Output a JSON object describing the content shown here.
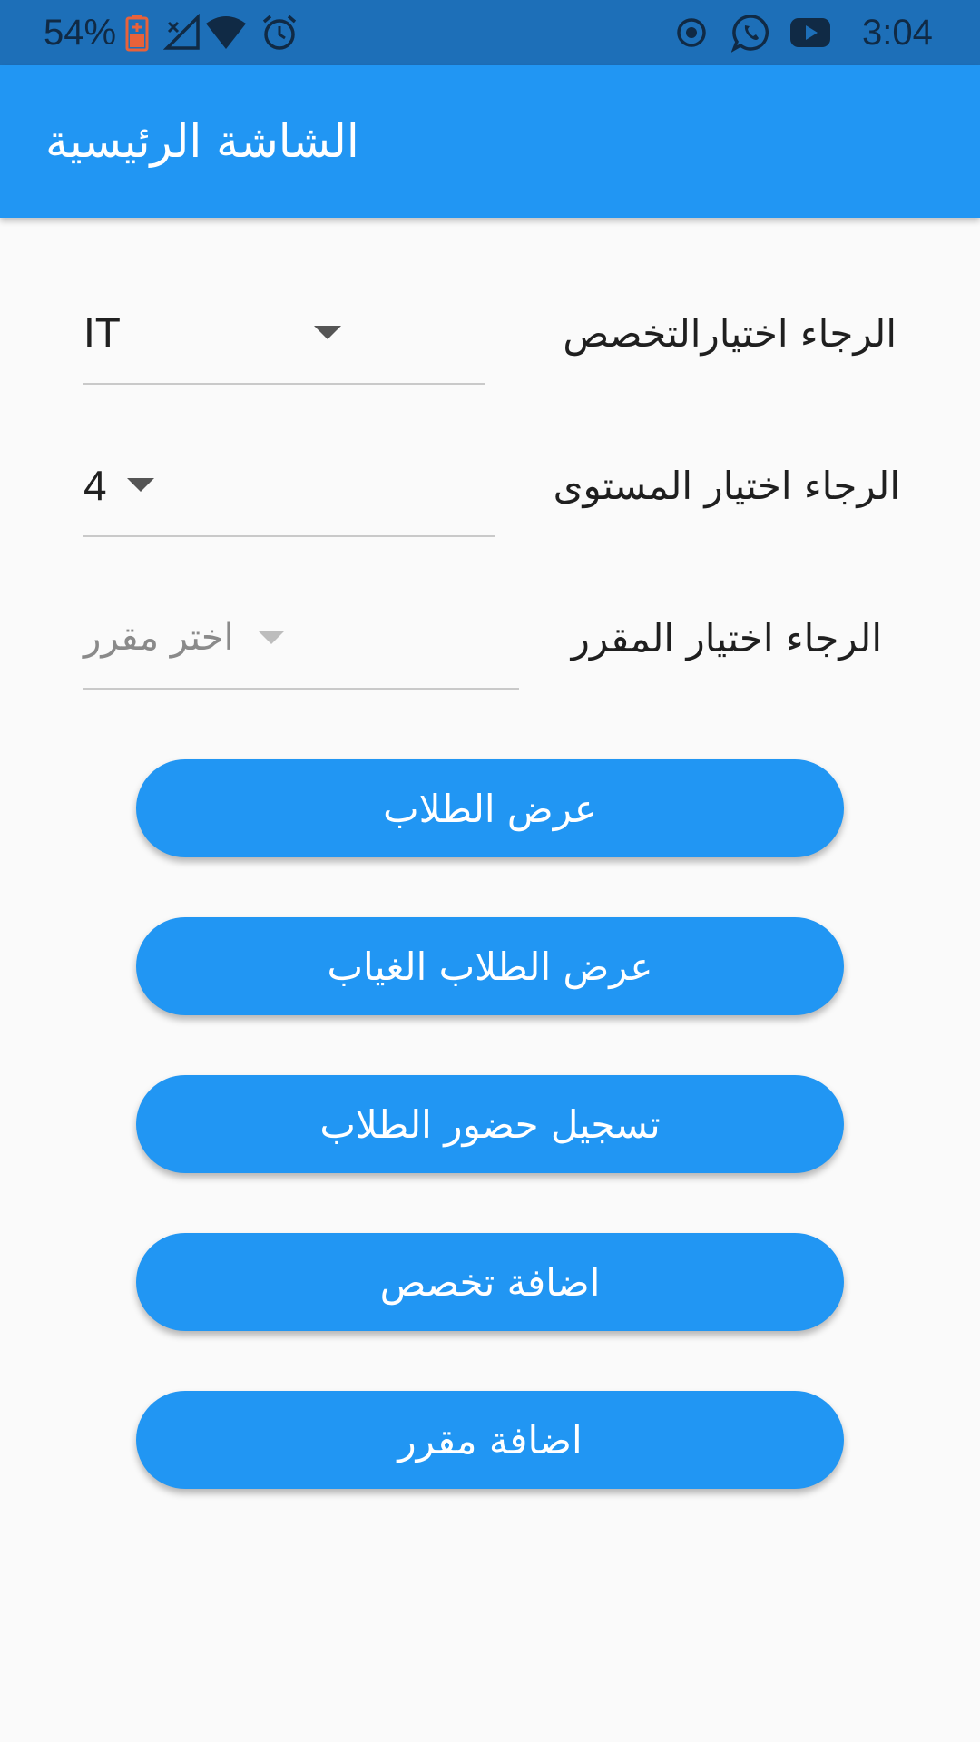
{
  "status_bar": {
    "battery_percent": "54%",
    "time": "3:04",
    "icons": [
      "battery-charging-icon",
      "no-sim-icon",
      "wifi-icon",
      "alarm-icon",
      "record-icon",
      "whatsapp-icon",
      "youtube-icon"
    ]
  },
  "app_bar": {
    "title": "الشاشة الرئيسية",
    "color": "#2196f3"
  },
  "form": {
    "specialization": {
      "label": "الرجاء اختيارالتخصص",
      "selected": "IT"
    },
    "level": {
      "label": "الرجاء اختيار المستوى",
      "selected": "4"
    },
    "course": {
      "label": "الرجاء اختيار المقرر",
      "placeholder": "اختر مقرر"
    }
  },
  "buttons": {
    "view_students": "عرض الطلاب",
    "view_absent_students": "عرض الطلاب الغياب",
    "record_attendance": "تسجيل حضور الطلاب",
    "add_specialization": "اضافة تخصص",
    "add_course": "اضافة مقرر"
  }
}
